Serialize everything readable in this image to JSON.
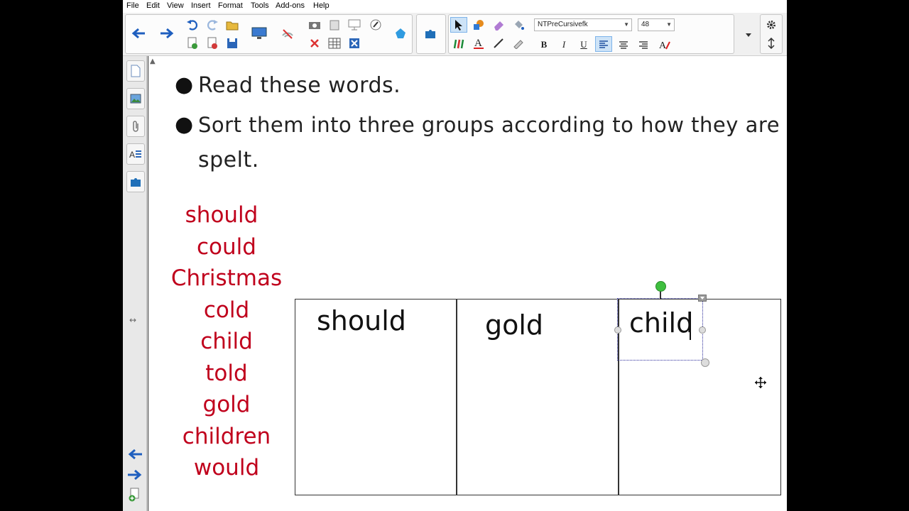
{
  "menu": [
    "File",
    "Edit",
    "View",
    "Insert",
    "Format",
    "Tools",
    "Add-ons",
    "Help"
  ],
  "toolbar": {
    "font_name": "NTPreCursivefk",
    "font_size": "48",
    "bold": "B",
    "italic": "I",
    "underline": "U"
  },
  "slide": {
    "instructions": [
      "Read these words.",
      "Sort them into three groups according to how they are",
      "spelt."
    ],
    "word_list": [
      "should",
      "could",
      "Christmas",
      "cold",
      "child",
      "told",
      "gold",
      "children",
      "would"
    ],
    "columns": [
      "should",
      "gold",
      "child"
    ]
  },
  "colors": {
    "word_list": "#c0001c",
    "rotate_handle": "#3fbf3f",
    "accent_blue": "#1f5fbf"
  }
}
